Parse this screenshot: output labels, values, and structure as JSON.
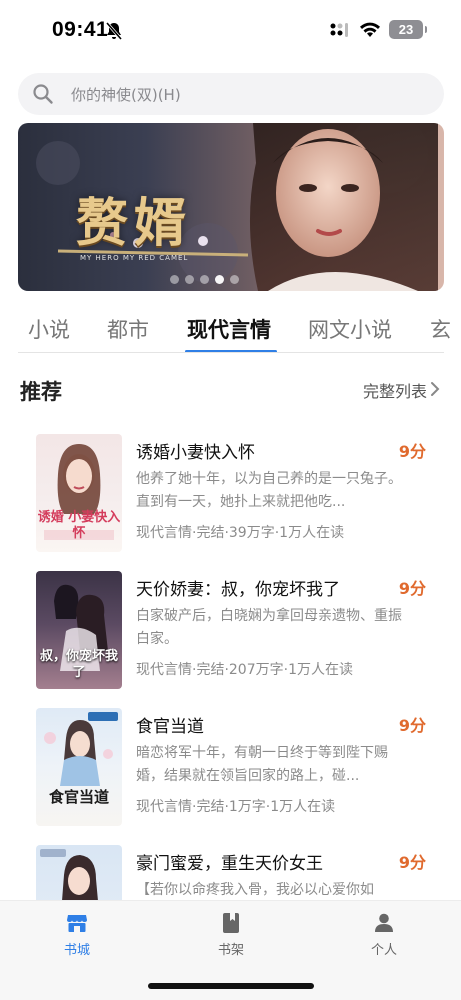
{
  "status_bar": {
    "time": "09:41",
    "battery": "23"
  },
  "search": {
    "placeholder": "你的神使(双)(H)"
  },
  "banner": {
    "title": "赘婿",
    "subtitle": "MY HERO  MY RED CAMEL",
    "dots": 5,
    "active_dot": 3
  },
  "tabs": [
    {
      "label": "小说"
    },
    {
      "label": "都市"
    },
    {
      "label": "现代言情"
    },
    {
      "label": "网文小说"
    },
    {
      "label": "玄"
    }
  ],
  "active_tab": "现代言情",
  "section": {
    "title": "推荐",
    "more_label": "完整列表"
  },
  "books": [
    {
      "title": "诱婚小妻快入怀",
      "score": "9分",
      "desc": "他养了她十年，以为自己养的是一只兔子。直到有一天，她扑上来就把他吃...",
      "meta": "现代言情·完结·39万字·1万人在读",
      "cover_text": "诱婚 小妻快入怀"
    },
    {
      "title": "天价娇妻：叔，你宠坏我了",
      "score": "9分",
      "desc": "白家破产后，白晓娴为拿回母亲遗物、重振白家。",
      "meta": "现代言情·完结·207万字·1万人在读",
      "cover_text": "叔，你宠坏我了"
    },
    {
      "title": "食官当道",
      "score": "9分",
      "desc": "暗恋将军十年，有朝一日终于等到陛下赐婚，结果就在领旨回家的路上，碰...",
      "meta": "现代言情·完结·1万字·1万人在读",
      "cover_text": "食官当道"
    },
    {
      "title": "豪门蜜爱，重生天价女王",
      "score": "9分",
      "desc": "【若你以命疼我入骨，我必以心爱你如",
      "meta": "",
      "cover_text": ""
    }
  ],
  "tabbar": [
    {
      "label": "书城",
      "icon": "store-icon",
      "active": true
    },
    {
      "label": "书架",
      "icon": "bookshelf-icon",
      "active": false
    },
    {
      "label": "个人",
      "icon": "person-icon",
      "active": false
    }
  ],
  "colors": {
    "accent": "#2f7fe6",
    "score": "#e06a2e"
  }
}
